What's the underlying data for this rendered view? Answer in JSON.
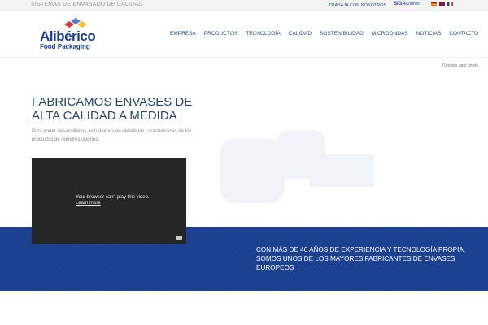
{
  "topbar": {
    "tagline": "SISTEMAS DE ENVASADO DE CALIDAD",
    "work_link": "TRABAJA CON NOSOTROS",
    "siga_bold": "SIGA",
    "siga_rest": "Connect",
    "flags": [
      {
        "lang": "es",
        "color": "#c60b1e"
      },
      {
        "lang": "en",
        "color": "#1a3f8f"
      },
      {
        "lang": "fr",
        "color": "#0055a4"
      }
    ]
  },
  "header": {
    "logo_brand": "Alibérico",
    "logo_sub": "Food Packaging",
    "nav": [
      "EMPRESA",
      "PRODUCTOS",
      "TECNOLOGÍA",
      "CALIDAD",
      "SOSTENIBILIDAD",
      "MICROONDAS",
      "NOTICIAS",
      "CONTACTO"
    ]
  },
  "breadcrumb": "Tú estás aquí:  Inicio",
  "main": {
    "title": "FABRICAMOS ENVASES DE ALTA CALIDAD A MEDIDA",
    "paragraph": "Para poder desarrollarlos, estudiamos en detalle las características de los productos de nuestros clientes."
  },
  "video": {
    "message": "Your browser can't play this video.",
    "link": "Learn more"
  },
  "band": {
    "text": "CON MÁS DE 40 AÑOS DE EXPERIENCIA Y TECNOLOGÍA PROPIA, SOMOS UNOS DE LOS MAYORES FABRICANTES DE ENVASES EUROPEOS"
  },
  "colors": {
    "brand": "#1a3f8f"
  }
}
